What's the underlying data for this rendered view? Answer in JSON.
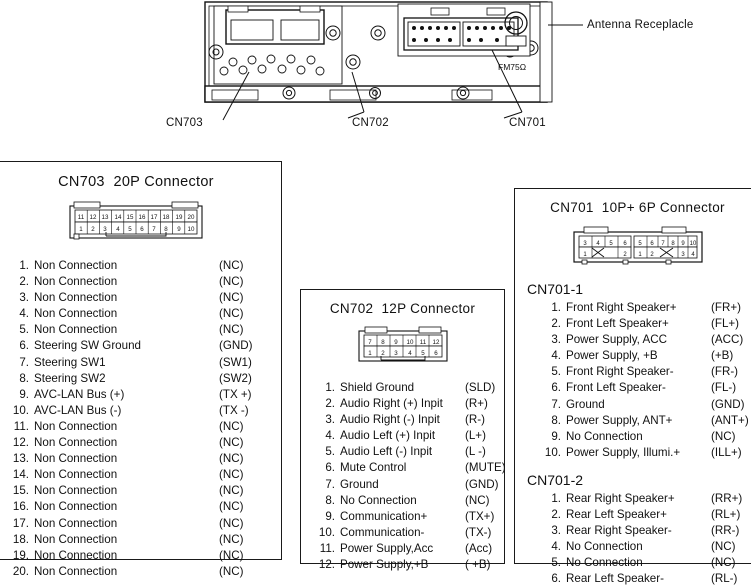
{
  "figure": {
    "callouts": {
      "cn703": "CN703",
      "cn702": "CN702",
      "cn701": "CN701",
      "antenna": "Antenna Receplacle",
      "fm_impedance": "FM75Ω"
    }
  },
  "panels": {
    "cn703": {
      "title": "CN703  20P Connector",
      "connector": {
        "top_row": [
          "11",
          "12",
          "13",
          "14",
          "15",
          "16",
          "17",
          "18",
          "19",
          "20"
        ],
        "bottom_row": [
          "1",
          "2",
          "3",
          "4",
          "5",
          "6",
          "7",
          "8",
          "9",
          "10"
        ]
      },
      "pins": [
        {
          "num": "1.",
          "name": "Non Connection",
          "code": "(NC)"
        },
        {
          "num": "2.",
          "name": "Non Connection",
          "code": "(NC)"
        },
        {
          "num": "3.",
          "name": "Non Connection",
          "code": "(NC)"
        },
        {
          "num": "4.",
          "name": "Non Connection",
          "code": "(NC)"
        },
        {
          "num": "5.",
          "name": "Non Connection",
          "code": "(NC)"
        },
        {
          "num": "6.",
          "name": "Steering SW Ground",
          "code": "(GND)"
        },
        {
          "num": "7.",
          "name": "Steering SW1",
          "code": "(SW1)"
        },
        {
          "num": "8.",
          "name": "Steering SW2",
          "code": "(SW2)"
        },
        {
          "num": "9.",
          "name": "AVC-LAN Bus (+)",
          "code": "(TX +)"
        },
        {
          "num": "10.",
          "name": "AVC-LAN Bus (-)",
          "code": "(TX -)"
        },
        {
          "num": "11.",
          "name": "Non Connection",
          "code": "(NC)"
        },
        {
          "num": "12.",
          "name": "Non Connection",
          "code": "(NC)"
        },
        {
          "num": "13.",
          "name": "Non Connection",
          "code": "(NC)"
        },
        {
          "num": "14.",
          "name": "Non Connection",
          "code": "(NC)"
        },
        {
          "num": "15.",
          "name": "Non Connection",
          "code": "(NC)"
        },
        {
          "num": "16.",
          "name": "Non Connection",
          "code": "(NC)"
        },
        {
          "num": "17.",
          "name": "Non Connection",
          "code": "(NC)"
        },
        {
          "num": "18.",
          "name": "Non Connection",
          "code": "(NC)"
        },
        {
          "num": "19.",
          "name": "Non Connection",
          "code": "(NC)"
        },
        {
          "num": "20.",
          "name": "Non Connection",
          "code": "(NC)"
        }
      ]
    },
    "cn702": {
      "title": "CN702  12P Connector",
      "connector": {
        "top_row": [
          "7",
          "8",
          "9",
          "10",
          "11",
          "12"
        ],
        "bottom_row": [
          "1",
          "2",
          "3",
          "4",
          "5",
          "6"
        ]
      },
      "pins": [
        {
          "num": "1.",
          "name": "Shield Ground",
          "code": "(SLD)"
        },
        {
          "num": "2.",
          "name": "Audio Right (+) Inpit",
          "code": "(R+)"
        },
        {
          "num": "3.",
          "name": "Audio Right (-) Inpit",
          "code": "(R-)"
        },
        {
          "num": "4.",
          "name": "Audio Left (+) Inpit",
          "code": "(L+)"
        },
        {
          "num": "5.",
          "name": "Audio Left (-) Inpit",
          "code": "(L -)"
        },
        {
          "num": "6.",
          "name": "Mute Control",
          "code": "(MUTE)"
        },
        {
          "num": "7.",
          "name": "Ground",
          "code": "(GND)"
        },
        {
          "num": "8.",
          "name": "No Connection",
          "code": "(NC)"
        },
        {
          "num": "9.",
          "name": "Communication+",
          "code": "(TX+)"
        },
        {
          "num": "10.",
          "name": "Communication-",
          "code": "(TX-)"
        },
        {
          "num": "11.",
          "name": "Power Supply,Acc",
          "code": "(Acc)"
        },
        {
          "num": "12.",
          "name": "Power Supply,+B",
          "code": "( +B)"
        }
      ]
    },
    "cn701": {
      "title": "CN701  10P+ 6P Connector",
      "connector": {
        "left_block": {
          "top_row": [
            "3",
            "4",
            "5",
            "6"
          ],
          "bottom_row": [
            "1",
            "",
            "",
            "2"
          ]
        },
        "right_block": {
          "top_row": [
            "5",
            "6",
            "7",
            "8",
            "9",
            "10"
          ],
          "bottom_row": [
            "1",
            "2",
            "",
            "",
            "3",
            "4"
          ]
        }
      },
      "sub1": {
        "heading": "CN701-1",
        "pins": [
          {
            "num": "1.",
            "name": "Front Right Speaker+",
            "code": "(FR+)"
          },
          {
            "num": "2.",
            "name": "Front Left Speaker+",
            "code": "(FL+)"
          },
          {
            "num": "3.",
            "name": "Power Supply, ACC",
            "code": "(ACC)"
          },
          {
            "num": "4.",
            "name": "Power Supply, +B",
            "code": "(+B)"
          },
          {
            "num": "5.",
            "name": "Front Right Speaker-",
            "code": "(FR-)"
          },
          {
            "num": "6.",
            "name": "Front Left Speaker-",
            "code": "(FL-)"
          },
          {
            "num": "7.",
            "name": "Ground",
            "code": "(GND)"
          },
          {
            "num": "8.",
            "name": "Power Supply, ANT+",
            "code": "(ANT+)"
          },
          {
            "num": "9.",
            "name": "No Connection",
            "code": "(NC)"
          },
          {
            "num": "10.",
            "name": "Power Supply, Illumi.+",
            "code": "(ILL+)"
          }
        ]
      },
      "sub2": {
        "heading": "CN701-2",
        "pins": [
          {
            "num": "1.",
            "name": "Rear Right Speaker+",
            "code": "(RR+)"
          },
          {
            "num": "2.",
            "name": "Rear Left Speaker+",
            "code": "(RL+)"
          },
          {
            "num": "3.",
            "name": "Rear Right Speaker-",
            "code": "(RR-)"
          },
          {
            "num": "4.",
            "name": "No Connection",
            "code": "(NC)"
          },
          {
            "num": "5.",
            "name": "No Connection",
            "code": "(NC)"
          },
          {
            "num": "6.",
            "name": "Rear Left Speaker-",
            "code": "(RL-)"
          }
        ]
      }
    }
  }
}
